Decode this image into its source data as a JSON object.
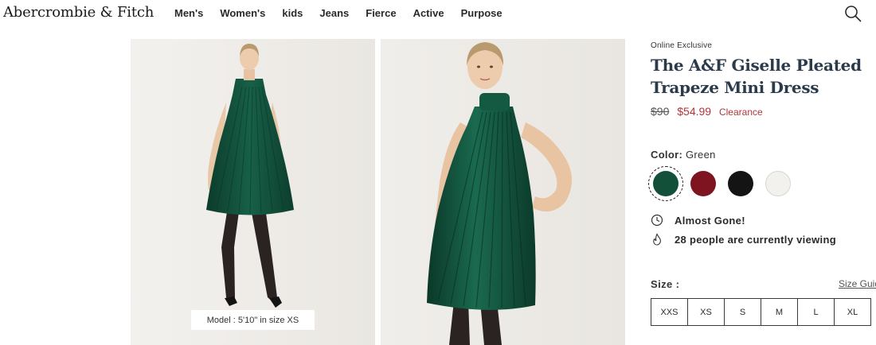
{
  "header": {
    "logo": "Abercrombie & Fitch",
    "nav": [
      "Men's",
      "Women's",
      "kids",
      "Jeans",
      "Fierce",
      "Active",
      "Purpose"
    ],
    "search_icon": "search-icon"
  },
  "gallery": {
    "model_caption": "Model : 5'10\" in size XS"
  },
  "product": {
    "badge": "Online Exclusive",
    "title": "The A&F Giselle Pleated Trapeze Mini Dress",
    "price_original": "$90",
    "price_sale": "$54.99",
    "price_tag": "Clearance",
    "color_label": "Color:",
    "color_value": "Green",
    "swatches": [
      {
        "name": "Green",
        "color": "#12503a",
        "selected": true
      },
      {
        "name": "Burgundy",
        "color": "#7d1420",
        "selected": false
      },
      {
        "name": "Black",
        "color": "#141414",
        "selected": false
      },
      {
        "name": "White",
        "color": "#f2f1ee",
        "selected": false
      }
    ],
    "status": [
      {
        "icon": "clock-icon",
        "text": "Almost Gone!"
      },
      {
        "icon": "flame-icon",
        "text": "28 people are currently viewing"
      }
    ],
    "size_label": "Size :",
    "size_guide": "Size Guide",
    "sizes": [
      "XXS",
      "XS",
      "S",
      "M",
      "L",
      "XL"
    ]
  },
  "colors": {
    "text": "#1b1b1b",
    "title": "#2b3b4b",
    "sale": "#b0363a",
    "dress_green": "#12503a"
  }
}
